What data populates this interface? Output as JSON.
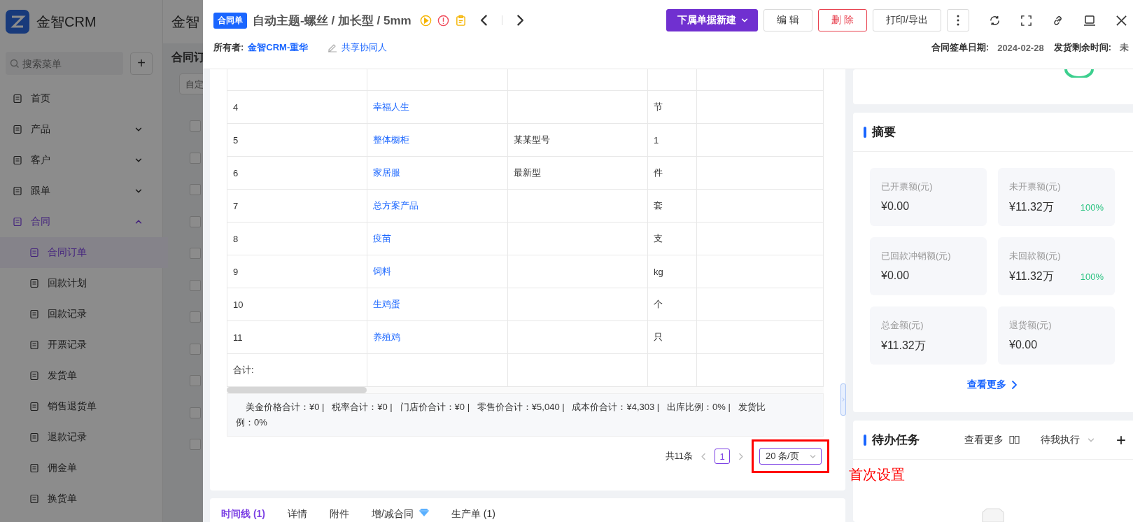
{
  "sidebar": {
    "logo_text": "金智CRM",
    "search_placeholder": "搜索菜单",
    "add_label": "+",
    "menu": [
      {
        "label": "首页",
        "selected": false
      },
      {
        "label": "产品",
        "selected": false,
        "expanded": false
      },
      {
        "label": "客户",
        "selected": false,
        "expanded": false
      },
      {
        "label": "跟单",
        "selected": false,
        "expanded": false
      },
      {
        "label": "合同",
        "selected": true,
        "expanded": true,
        "children": [
          {
            "label": "合同订单",
            "selected": true
          },
          {
            "label": "回款计划",
            "selected": false
          },
          {
            "label": "回款记录",
            "selected": false
          },
          {
            "label": "开票记录",
            "selected": false
          },
          {
            "label": "发货单",
            "selected": false
          },
          {
            "label": "销售退货单",
            "selected": false
          },
          {
            "label": "退款记录",
            "selected": false
          },
          {
            "label": "佣金单",
            "selected": false
          },
          {
            "label": "换货单",
            "selected": false
          }
        ]
      }
    ]
  },
  "main": {
    "header_title": "金智",
    "page_title": "合同订",
    "filter_placeholder": "自定",
    "row_checkboxes": [
      {
        "checked": false
      },
      {
        "checked": false
      },
      {
        "checked": false
      },
      {
        "checked": false
      },
      {
        "checked": false
      },
      {
        "checked": false
      },
      {
        "checked": false
      },
      {
        "checked": false
      },
      {
        "checked": false
      },
      {
        "checked": false
      },
      {
        "checked": false
      }
    ]
  },
  "drawer": {
    "tag": "合同单",
    "title": "自动主题-螺丝 / 加长型 / 5mm",
    "actions": [
      {
        "label": "下属单据新建",
        "kind": "primary"
      },
      {
        "label": "编 辑",
        "kind": "default"
      },
      {
        "label": "删 除",
        "kind": "danger"
      },
      {
        "label": "打印/导出",
        "kind": "default"
      }
    ],
    "owner": {
      "label": "所有者:",
      "value": "金智CRM-重华"
    },
    "share_label": "共享协同人",
    "meta": [
      {
        "label": "合同签单日期:",
        "value": "2024-02-28"
      },
      {
        "label": "发货剩余时间:",
        "value": "未"
      }
    ],
    "table": {
      "rows": [
        {
          "no": "4",
          "name": "幸福人生",
          "unit": "节"
        },
        {
          "no": "5",
          "name": "整体橱柜",
          "model": "某某型号",
          "unit": "1"
        },
        {
          "no": "6",
          "name": "家居服",
          "model": "最新型",
          "unit": "件"
        },
        {
          "no": "7",
          "name": "总方案产品",
          "unit": "套"
        },
        {
          "no": "8",
          "name": "疫苗",
          "unit": "支"
        },
        {
          "no": "9",
          "name": "饲料",
          "unit": "kg"
        },
        {
          "no": "10",
          "name": "生鸡蛋",
          "unit": "个"
        },
        {
          "no": "11",
          "name": "养殖鸡",
          "unit": "只"
        }
      ],
      "total_label": "合计:",
      "summary": "美金价格合计：¥0 |   税率合计：¥0 |   门店价合计：¥0 |   零售价合计：¥5,040 |   成本价合计：¥4,303 |   出库比例：0% |   发货比例：0%"
    },
    "pagination": {
      "total": "共11条",
      "pages": [
        {
          "label": "1",
          "selected": true
        }
      ],
      "page_size": "20 条/页"
    },
    "annotation": "首次设置",
    "tabs": [
      {
        "label": "时间线 (1)",
        "selected": true
      },
      {
        "label": "详情",
        "selected": false
      },
      {
        "label": "附件",
        "selected": false
      },
      {
        "label": "增/减合同",
        "selected": false,
        "gem": true
      },
      {
        "label": "生产单 (1)",
        "selected": false
      }
    ],
    "summary_card": {
      "title": "摘要",
      "tiles": [
        {
          "label": "已开票额(元)",
          "value": "¥0.00"
        },
        {
          "label": "未开票额(元)",
          "value": "¥11.32万",
          "percent": "100%"
        },
        {
          "label": "已回款冲销额(元)",
          "value": "¥0.00"
        },
        {
          "label": "未回款额(元)",
          "value": "¥11.32万",
          "percent": "100%"
        },
        {
          "label": "总金额(元)",
          "value": "¥11.32万"
        },
        {
          "label": "退货额(元)",
          "value": "¥0.00"
        }
      ],
      "more_label": "查看更多"
    },
    "tasks_card": {
      "title": "待办任务",
      "more_label": "查看更多",
      "filter": "待我执行",
      "add_label": "+"
    }
  }
}
